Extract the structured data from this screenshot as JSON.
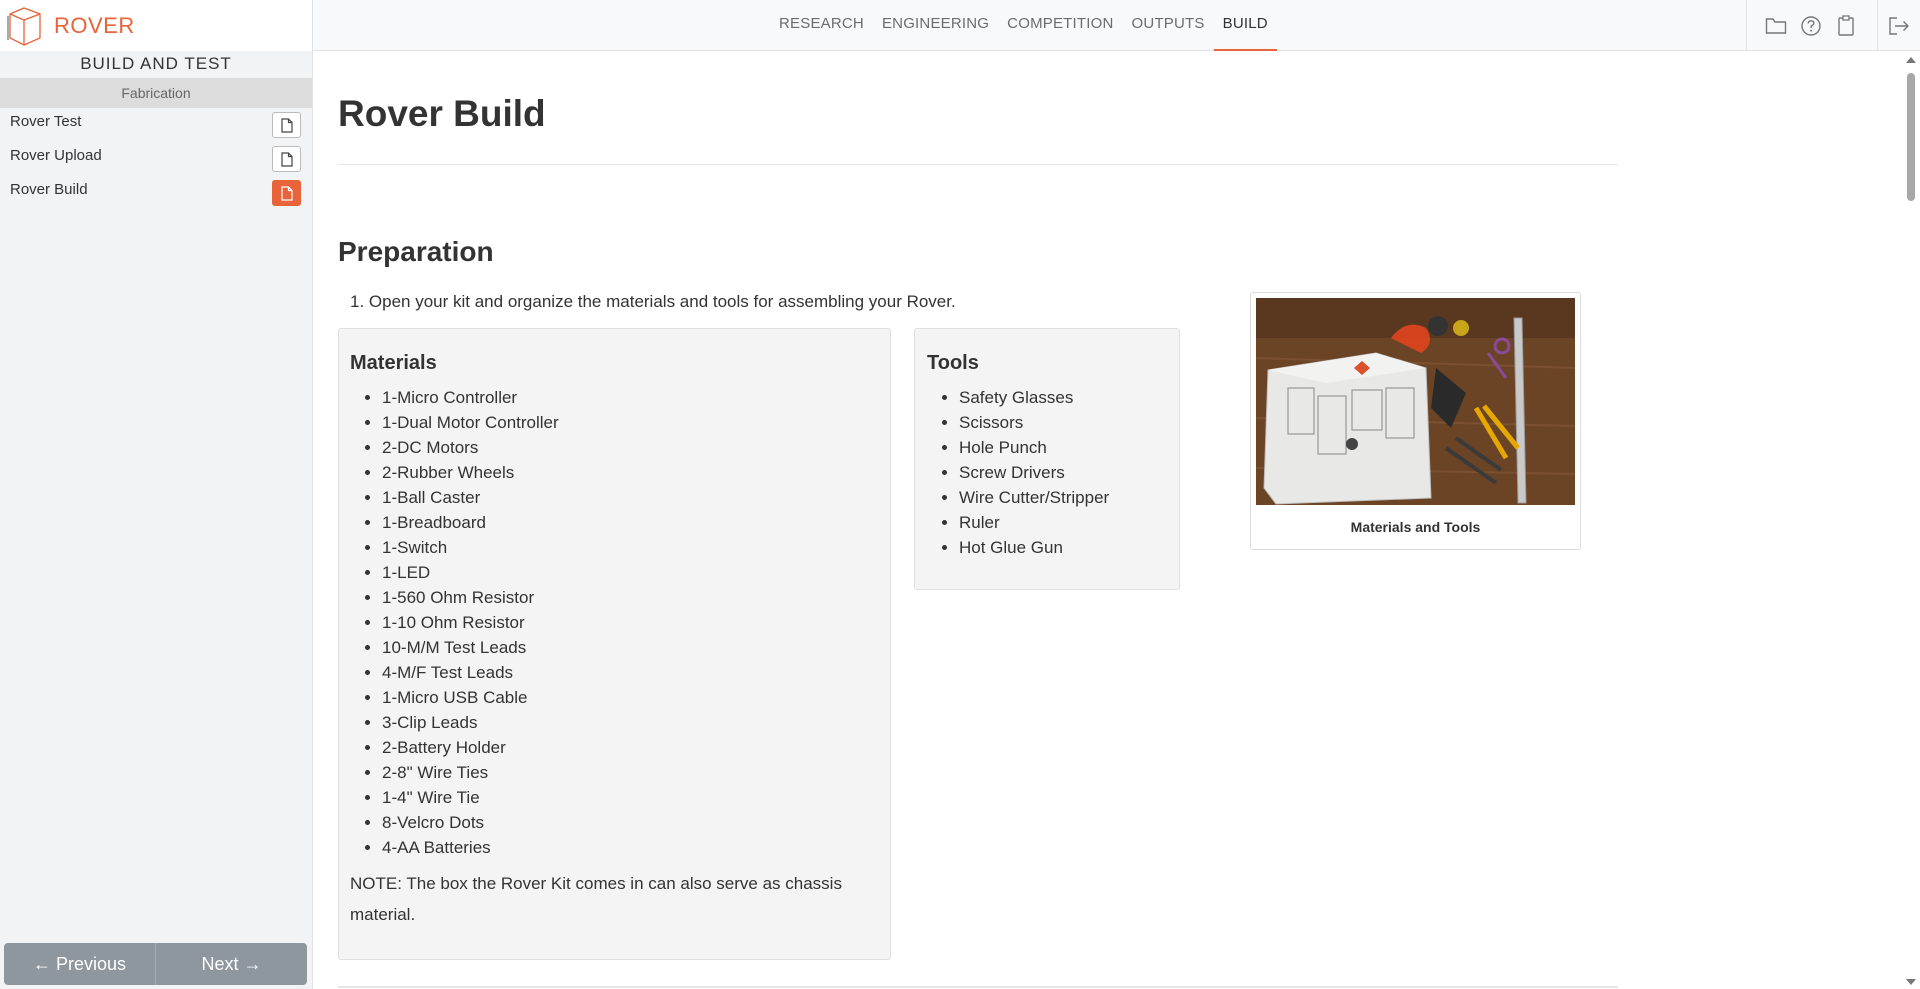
{
  "app": {
    "brand": "ROVER",
    "accent": "#e8623a"
  },
  "nav": {
    "items": [
      "RESEARCH",
      "ENGINEERING",
      "COMPETITION",
      "OUTPUTS",
      "BUILD"
    ],
    "active": "BUILD"
  },
  "toolbar": {
    "icons": [
      "folder-icon",
      "help-icon",
      "clipboard-icon",
      "logout-icon"
    ]
  },
  "sidebar": {
    "section_title": "BUILD AND TEST",
    "subsection": "Fabrication",
    "items": [
      {
        "label": "Rover Test",
        "active": false
      },
      {
        "label": "Rover Upload",
        "active": false
      },
      {
        "label": "Rover Build",
        "active": true
      }
    ],
    "pager": {
      "previous": "← Previous",
      "next": "Next →"
    }
  },
  "main": {
    "title": "Rover Build",
    "section": "Preparation",
    "step1": "1. Open your kit and organize the materials and tools for assembling your Rover.",
    "materials": {
      "heading": "Materials",
      "items": [
        "1-Micro Controller",
        "1-Dual Motor Controller",
        "2-DC Motors",
        "2-Rubber Wheels",
        "1-Ball Caster",
        "1-Breadboard",
        "1-Switch",
        "1-LED",
        "1-560 Ohm Resistor",
        "1-10 Ohm Resistor",
        "10-M/M Test Leads",
        "4-M/F Test Leads",
        "1-Micro USB Cable",
        "3-Clip Leads",
        "2-Battery Holder",
        "2-8\" Wire Ties",
        "1-4\" Wire Tie",
        "8-Velcro Dots",
        "4-AA Batteries"
      ],
      "note": "NOTE: The box the Rover Kit comes in can also serve as chassis material."
    },
    "tools": {
      "heading": "Tools",
      "items": [
        "Safety Glasses",
        "Scissors",
        "Hole Punch",
        "Screw Drivers",
        "Wire Cutter/Stripper",
        "Ruler",
        "Hot Glue Gun"
      ]
    },
    "figure": {
      "caption": "Materials and Tools"
    }
  }
}
